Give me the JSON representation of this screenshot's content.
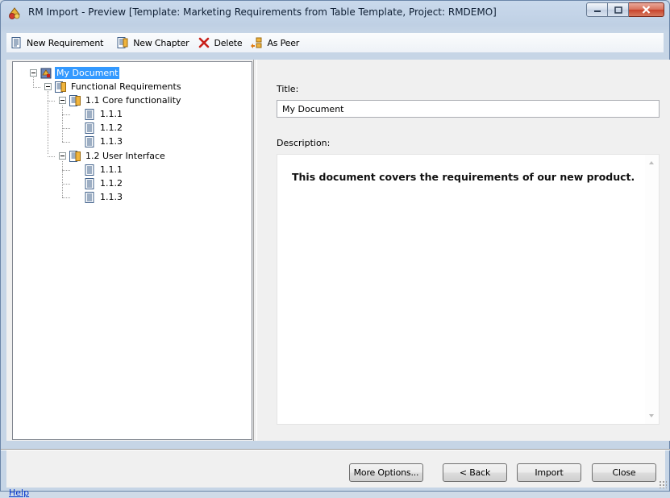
{
  "window": {
    "title": "RM Import - Preview [Template: Marketing Requirements from Table Template, Project: RMDEMO]"
  },
  "toolbar": {
    "new_requirement": "New Requirement",
    "new_chapter": "New Chapter",
    "delete": "Delete",
    "as_peer": "As Peer"
  },
  "tree": {
    "root": "My Document",
    "functional": "Functional Requirements",
    "chapter1": "1.1 Core functionality",
    "ch1_items": [
      "1.1.1",
      "1.1.2",
      "1.1.3"
    ],
    "chapter2": "1.2 User Interface",
    "ch2_items": [
      "1.1.1",
      "1.1.2",
      "1.1.3"
    ]
  },
  "details": {
    "title_label": "Title:",
    "title_value": "My Document",
    "description_label": "Description:",
    "description_text": "This document covers the requirements of our new product."
  },
  "footer": {
    "help": "Help",
    "more_options": "More Options...",
    "back": "< Back",
    "import": "Import",
    "close": "Close"
  },
  "colors": {
    "selection": "#3399ff",
    "link": "#0033cc",
    "close_button": "#c7422b"
  }
}
